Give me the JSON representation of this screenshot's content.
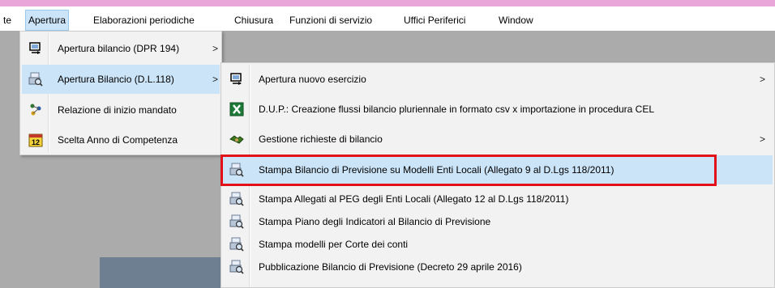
{
  "menubar": {
    "items": [
      {
        "label": "te"
      },
      {
        "label": "Apertura",
        "active": true
      },
      {
        "label": "Elaborazioni periodiche"
      },
      {
        "label": "Chiusura"
      },
      {
        "label": "Funzioni di servizio"
      },
      {
        "label": "Uffici Periferici"
      },
      {
        "label": "Window"
      }
    ]
  },
  "apertura_menu": {
    "items": [
      {
        "label": "Apertura bilancio (DPR 194)",
        "arrow": ">",
        "icon": "computer-arrow-icon"
      },
      {
        "label": "Apertura Bilancio (D.L.118)",
        "arrow": ">",
        "icon": "print-preview-icon",
        "highlighted": true
      },
      {
        "label": "Relazione di inizio mandato",
        "icon": "people-network-icon"
      },
      {
        "label": "Scelta Anno di Competenza",
        "icon": "calendar-icon"
      }
    ]
  },
  "submenu": {
    "items": [
      {
        "label": "Apertura nuovo esercizio",
        "arrow": ">",
        "icon": "computer-arrow-icon"
      },
      {
        "label": "D.U.P.: Creazione flussi bilancio pluriennale in formato csv x importazione in procedura CEL",
        "icon": "excel-icon"
      },
      {
        "label": "Gestione richieste di bilancio",
        "arrow": ">",
        "icon": "handshake-icon"
      },
      {
        "label": "Stampa Bilancio di Previsione su Modelli Enti Locali (Allegato 9 al D.Lgs 118/2011)",
        "icon": "print-preview-icon",
        "highlighted": true,
        "boxed": true
      },
      {
        "label": "Stampa Allegati al PEG degli Enti Locali (Allegato 12 al D.Lgs 118/2011)",
        "icon": "print-preview-icon"
      },
      {
        "label": "Stampa Piano degli Indicatori al Bilancio di Previsione",
        "icon": "print-preview-icon"
      },
      {
        "label": "Stampa modelli per Corte dei conti",
        "icon": "print-preview-icon"
      },
      {
        "label": "Pubblicazione Bilancio di Previsione (Decreto 29 aprile 2016)",
        "icon": "print-preview-icon"
      }
    ]
  },
  "colors": {
    "accent_highlight": "#cce4f7",
    "annotation_box": "#e3101a",
    "title_stripe": "#e9a6d8"
  }
}
